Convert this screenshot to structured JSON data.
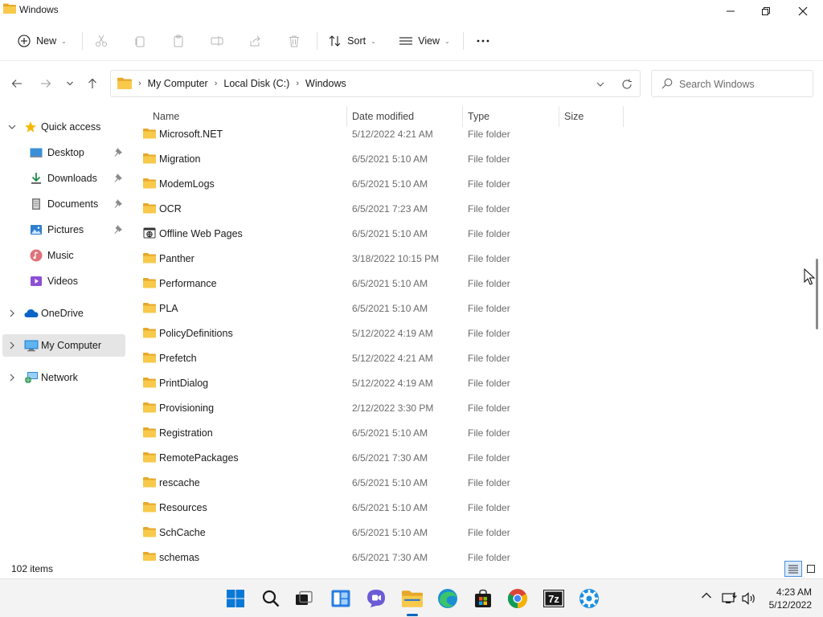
{
  "window": {
    "title": "Windows"
  },
  "commandbar": {
    "new_label": "New",
    "sort_label": "Sort",
    "view_label": "View",
    "more_label": "..."
  },
  "address": {
    "crumbs": [
      "My Computer",
      "Local Disk (C:)",
      "Windows"
    ]
  },
  "search": {
    "placeholder": "Search Windows"
  },
  "nav": {
    "quick_access": "Quick access",
    "desktop": "Desktop",
    "downloads": "Downloads",
    "documents": "Documents",
    "pictures": "Pictures",
    "music": "Music",
    "videos": "Videos",
    "onedrive": "OneDrive",
    "my_computer": "My Computer",
    "network": "Network"
  },
  "columns": {
    "name": "Name",
    "date": "Date modified",
    "type": "Type",
    "size": "Size"
  },
  "files": [
    {
      "name": "Microsoft.NET",
      "date": "5/12/2022 4:21 AM",
      "type": "File folder",
      "icon": "folder"
    },
    {
      "name": "Migration",
      "date": "6/5/2021 5:10 AM",
      "type": "File folder",
      "icon": "folder"
    },
    {
      "name": "ModemLogs",
      "date": "6/5/2021 5:10 AM",
      "type": "File folder",
      "icon": "folder"
    },
    {
      "name": "OCR",
      "date": "6/5/2021 7:23 AM",
      "type": "File folder",
      "icon": "folder"
    },
    {
      "name": "Offline Web Pages",
      "date": "6/5/2021 5:10 AM",
      "type": "File folder",
      "icon": "web-folder"
    },
    {
      "name": "Panther",
      "date": "3/18/2022 10:15 PM",
      "type": "File folder",
      "icon": "folder"
    },
    {
      "name": "Performance",
      "date": "6/5/2021 5:10 AM",
      "type": "File folder",
      "icon": "folder"
    },
    {
      "name": "PLA",
      "date": "6/5/2021 5:10 AM",
      "type": "File folder",
      "icon": "folder"
    },
    {
      "name": "PolicyDefinitions",
      "date": "5/12/2022 4:19 AM",
      "type": "File folder",
      "icon": "folder"
    },
    {
      "name": "Prefetch",
      "date": "5/12/2022 4:21 AM",
      "type": "File folder",
      "icon": "folder"
    },
    {
      "name": "PrintDialog",
      "date": "5/12/2022 4:19 AM",
      "type": "File folder",
      "icon": "folder"
    },
    {
      "name": "Provisioning",
      "date": "2/12/2022 3:30 PM",
      "type": "File folder",
      "icon": "folder"
    },
    {
      "name": "Registration",
      "date": "6/5/2021 5:10 AM",
      "type": "File folder",
      "icon": "folder"
    },
    {
      "name": "RemotePackages",
      "date": "6/5/2021 7:30 AM",
      "type": "File folder",
      "icon": "folder"
    },
    {
      "name": "rescache",
      "date": "6/5/2021 5:10 AM",
      "type": "File folder",
      "icon": "folder"
    },
    {
      "name": "Resources",
      "date": "6/5/2021 5:10 AM",
      "type": "File folder",
      "icon": "folder"
    },
    {
      "name": "SchCache",
      "date": "6/5/2021 5:10 AM",
      "type": "File folder",
      "icon": "folder"
    },
    {
      "name": "schemas",
      "date": "6/5/2021 7:30 AM",
      "type": "File folder",
      "icon": "folder"
    }
  ],
  "status": {
    "item_count": "102 items"
  },
  "clock": {
    "time": "4:23 AM",
    "date": "5/12/2022"
  },
  "colors": {
    "folder": "#f8c94b",
    "folder_dark": "#e6a82a",
    "accent": "#0067c0",
    "selected_bg": "#e5e5e5"
  }
}
